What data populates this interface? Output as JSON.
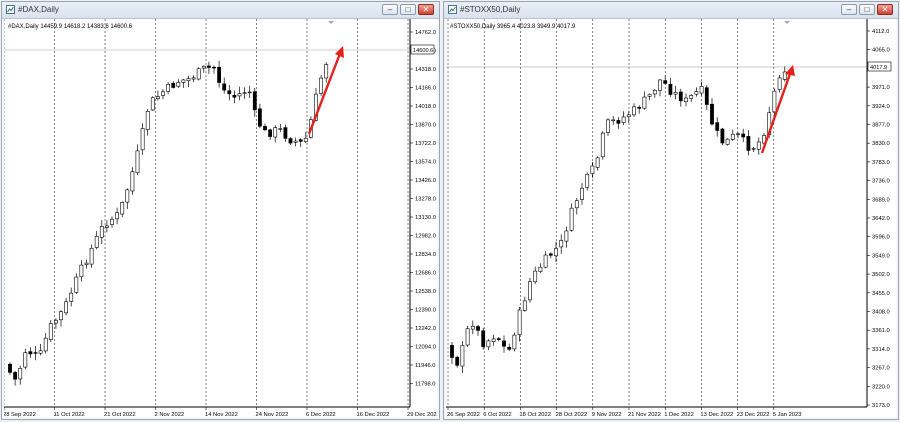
{
  "windows": [
    {
      "id": "dax",
      "title": "#DAX,Daily",
      "info": "#DAX,Daily  14459.9 14618.2 14383.6 14600.6",
      "current_price": "14600.6",
      "buttons": {
        "minimize": "–",
        "maximize": "□",
        "close": "✕"
      },
      "y_ticks": [
        "14762.0",
        "14466.0",
        "14318.0",
        "14166.0",
        "14018.0",
        "13870.0",
        "13722.0",
        "13574.0",
        "13426.0",
        "13278.0",
        "13130.0",
        "12982.0",
        "12834.0",
        "12686.0",
        "12538.0",
        "12390.0",
        "12242.0",
        "12094.0",
        "11946.0",
        "11798.0"
      ],
      "x_ticks": [
        "28 Sep 2022",
        "11 Oct 2022",
        "21 Oct 2022",
        "2 Nov 2022",
        "14 Nov 2022",
        "24 Nov 2022",
        "6 Dec 2022",
        "16 Dec 2022",
        "29 Dec 2022"
      ],
      "arrow_color": "#e8201c"
    },
    {
      "id": "stoxx",
      "title": "#STOXX50,Daily",
      "info": "#STOXX50,Daily  3965.4 4023.8 3949.9 4017.9",
      "current_price": "4017.9",
      "buttons": {
        "minimize": "–",
        "maximize": "□",
        "close": "✕"
      },
      "y_ticks": [
        "4112.0",
        "4065.0",
        "4017.9",
        "3971.0",
        "3924.0",
        "3877.0",
        "3830.0",
        "3783.0",
        "3736.0",
        "3689.0",
        "3642.0",
        "3596.0",
        "3549.0",
        "3502.0",
        "3455.0",
        "3408.0",
        "3361.0",
        "3314.0",
        "3267.0",
        "3220.0",
        "3173.0"
      ],
      "x_ticks": [
        "26 Sep 2022",
        "6 Oct 2022",
        "18 Oct 2022",
        "28 Oct 2022",
        "9 Nov 2022",
        "21 Nov 2022",
        "1 Dec 2022",
        "13 Dec 2022",
        "23 Dec 2022",
        "5 Jan 2023"
      ],
      "arrow_color": "#e8201c"
    }
  ],
  "colors": {
    "bull": "#ffffff",
    "bear": "#000000",
    "axis_text": "#000000",
    "grid": "#000000"
  }
}
